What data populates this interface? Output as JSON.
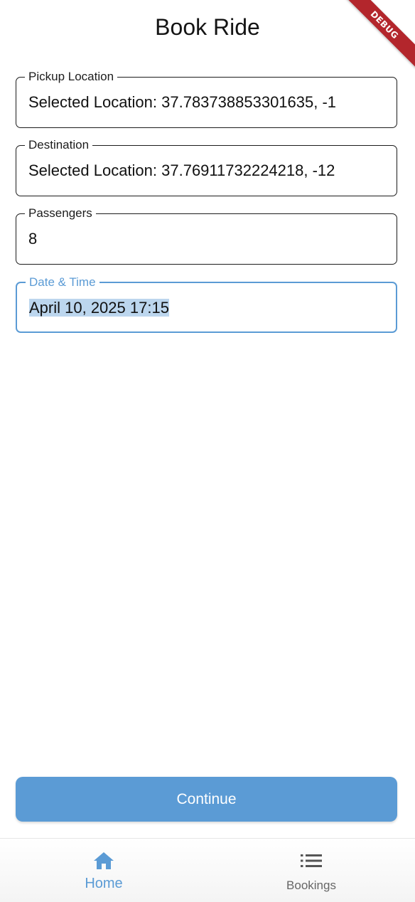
{
  "app": {
    "title": "Book Ride",
    "debug_banner": "DEBUG"
  },
  "form": {
    "pickup": {
      "label": "Pickup Location",
      "value": "Selected Location: 37.783738853301635, -1"
    },
    "destination": {
      "label": "Destination",
      "value": "Selected Location: 37.76911732224218, -12"
    },
    "passengers": {
      "label": "Passengers",
      "value": "8"
    },
    "datetime": {
      "label": "Date & Time",
      "value": "April 10, 2025 17:15",
      "focused": true
    }
  },
  "actions": {
    "continue_label": "Continue"
  },
  "bottom_nav": {
    "items": [
      {
        "label": "Home",
        "icon": "home-icon",
        "active": true
      },
      {
        "label": "Bookings",
        "icon": "list-icon",
        "active": false
      }
    ]
  },
  "colors": {
    "accent": "#5b9bd5",
    "selection": "#bcd6ee",
    "debug": "#b3262c"
  }
}
